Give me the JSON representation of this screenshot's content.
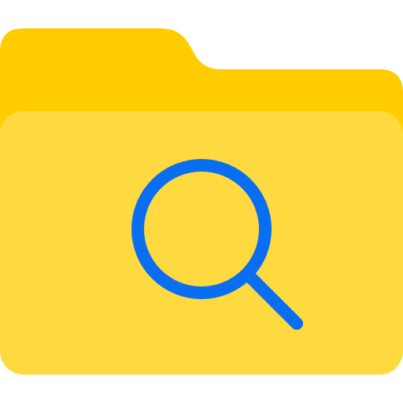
{
  "icon": {
    "name": "folder-search-icon",
    "colors": {
      "folder_back": "#FFCC00",
      "folder_front": "#FFD940",
      "magnifier": "#0A6EF0",
      "background": "#FFFFFF"
    }
  }
}
